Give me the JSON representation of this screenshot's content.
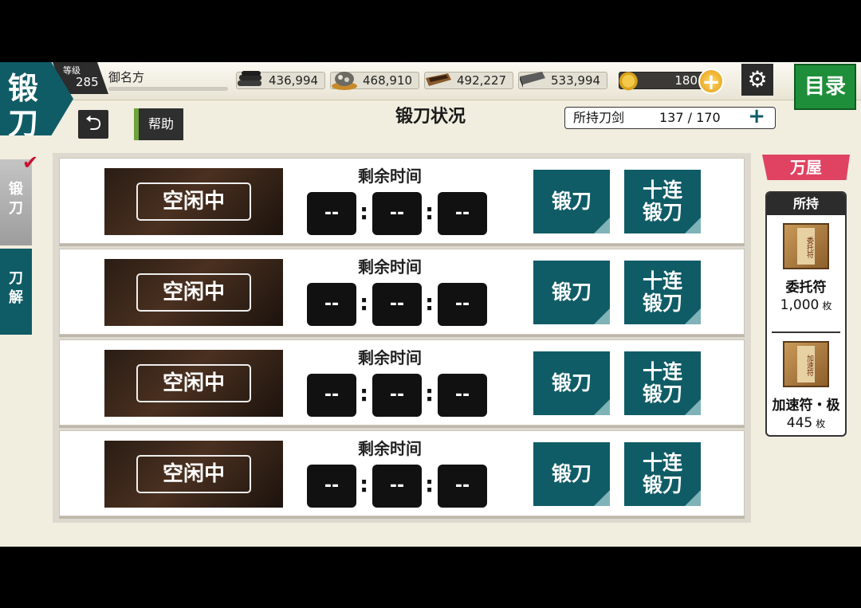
{
  "header": {
    "title_line1": "锻",
    "title_line2": "刀",
    "level_label": "等级",
    "level": "285",
    "player_name": "御名方",
    "resources": [
      {
        "name": "charcoal",
        "icon": "charcoal-icon",
        "value": "436,994"
      },
      {
        "name": "tamahagane",
        "icon": "tamahagane-icon",
        "value": "468,910"
      },
      {
        "name": "cooling-water",
        "icon": "cooling-water-icon",
        "value": "492,227"
      },
      {
        "name": "whetstone",
        "icon": "whetstone-icon",
        "value": "533,994"
      }
    ],
    "koban": {
      "icon": "koban-coin-icon",
      "value": "180"
    },
    "plus_symbol": "+",
    "settings_icon": "⚙",
    "menu_label": "目录"
  },
  "subheader": {
    "back_icon": "⮌",
    "help_label": "帮助",
    "page_title": "锻刀状况",
    "swords_label": "所持刀剑",
    "swords_value": "137 / 170",
    "swords_add": "+"
  },
  "side_tabs": {
    "forge_label": "锻刀",
    "dismantle_label": "刀解",
    "check": "✔"
  },
  "forge_slots": [
    {
      "status": "空闲中",
      "remain_label": "剩余时间",
      "h": "--",
      "m": "--",
      "s": "--",
      "forge_btn": "锻刀",
      "multi_line1": "十连",
      "multi_line2": "锻刀"
    },
    {
      "status": "空闲中",
      "remain_label": "剩余时间",
      "h": "--",
      "m": "--",
      "s": "--",
      "forge_btn": "锻刀",
      "multi_line1": "十连",
      "multi_line2": "锻刀"
    },
    {
      "status": "空闲中",
      "remain_label": "剩余时间",
      "h": "--",
      "m": "--",
      "s": "--",
      "forge_btn": "锻刀",
      "multi_line1": "十连",
      "multi_line2": "锻刀"
    },
    {
      "status": "空闲中",
      "remain_label": "剩余时间",
      "h": "--",
      "m": "--",
      "s": "--",
      "forge_btn": "锻刀",
      "multi_line1": "十连",
      "multi_line2": "锻刀"
    }
  ],
  "colon": ":",
  "shop": {
    "label": "万屋"
  },
  "inventory": {
    "header": "所持",
    "items": [
      {
        "talisman_text": "委托符",
        "name": "委托符",
        "count": "1,000",
        "unit": "枚"
      },
      {
        "talisman_text": "加速符",
        "name": "加速符・极",
        "count": "445",
        "unit": "枚"
      }
    ]
  },
  "colors": {
    "teal": "#0f5c66",
    "green": "#1f8e3a",
    "pink": "#e04262",
    "gold": "#e49b0f"
  }
}
